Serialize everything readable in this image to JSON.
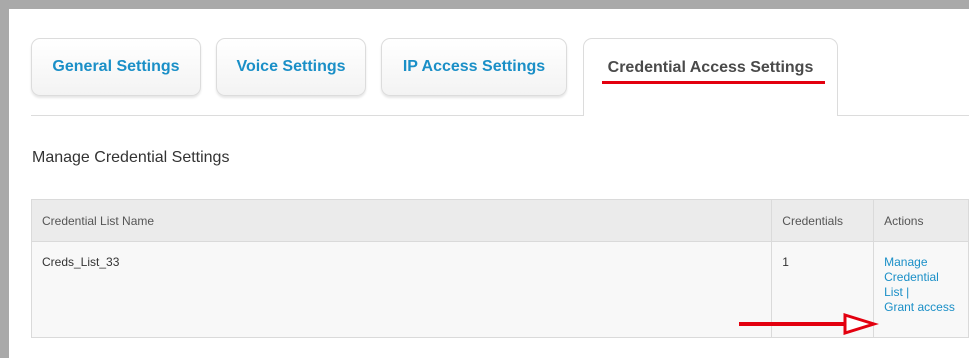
{
  "tabs": [
    {
      "label": "General Settings",
      "active": false
    },
    {
      "label": "Voice Settings",
      "active": false
    },
    {
      "label": "IP Access Settings",
      "active": false
    },
    {
      "label": "Credential Access Settings",
      "active": true
    }
  ],
  "section": {
    "title": "Manage Credential Settings"
  },
  "table": {
    "headers": {
      "name": "Credential List Name",
      "credentials": "Credentials",
      "actions": "Actions"
    },
    "rows": [
      {
        "name": "Creds_List_33",
        "credentials": "1",
        "manage_line1": "Manage",
        "manage_line2": "Credential",
        "manage_line3": "List",
        "separator": "|",
        "grant": "Grant access"
      }
    ]
  },
  "colors": {
    "link": "#1a8fc7",
    "annotation_red": "#e3000f",
    "active_tab_text": "#4a4a4a"
  },
  "annotations": {
    "underline_target": "tab-credential-access-settings",
    "arrow_target": "grant-access-link",
    "arrow_icon": "right-arrow-icon"
  }
}
